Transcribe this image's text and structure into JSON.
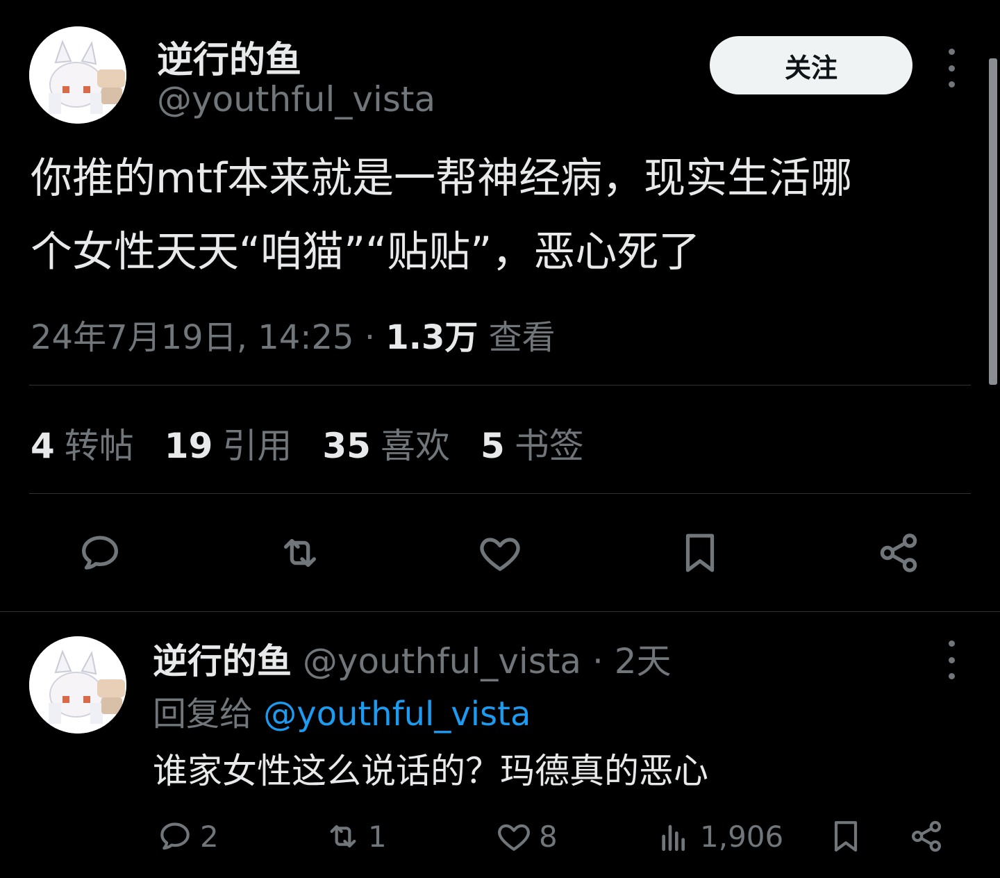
{
  "tweet": {
    "author_name": "逆行的鱼",
    "author_handle": "@youthful_vista",
    "follow_label": "关注",
    "text_line1": "你推的mtf本来就是一帮神经病，现实生活哪",
    "text_line2": "个女性天天“咱猫”“贴贴”，恶心死了",
    "timestamp": "24年7月19日, 14:25",
    "separator": "·",
    "views_count": "1.3万",
    "views_label": "查看",
    "stats": {
      "reposts_count": "4",
      "reposts_label": "转帖",
      "quotes_count": "19",
      "quotes_label": "引用",
      "likes_count": "35",
      "likes_label": "喜欢",
      "bookmarks_count": "5",
      "bookmarks_label": "书签"
    }
  },
  "reply": {
    "author_name": "逆行的鱼",
    "author_handle": "@youthful_vista",
    "separator": "·",
    "time": "2天",
    "reply_prefix": "回复给",
    "reply_to_handle": "@youthful_vista",
    "text": "谁家女性这么说话的？玛德真的恶心",
    "counts": {
      "replies": "2",
      "reposts": "1",
      "likes": "8",
      "views": "1,906"
    }
  },
  "colors": {
    "background": "#000000",
    "text": "#e7e9ea",
    "muted": "#71767b",
    "link": "#1d9bf0",
    "divider": "#2f3336"
  },
  "icons": [
    "comment-icon",
    "repost-icon",
    "heart-icon",
    "bookmark-icon",
    "share-icon",
    "views-icon",
    "more-icon"
  ]
}
